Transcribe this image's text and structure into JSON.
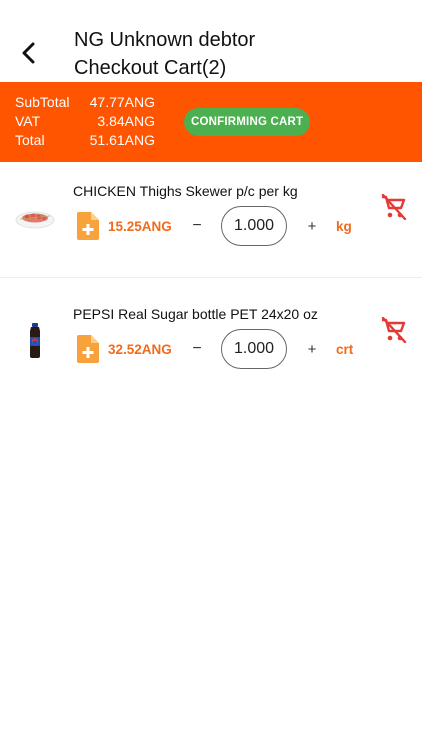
{
  "header": {
    "title_line1": "NG Unknown debtor",
    "title_line2": "Checkout Cart(2)"
  },
  "totals": {
    "subtotal_label": "SubTotal",
    "subtotal_value": "47.77ANG",
    "vat_label": "VAT",
    "vat_value": "3.84ANG",
    "total_label": "Total",
    "total_value": "51.61ANG",
    "confirm_label": "CONFIRMING CART"
  },
  "items": [
    {
      "name": "CHICKEN Thighs Skewer p/c per kg",
      "price": "15.25ANG",
      "minus": "−",
      "quantity": "1.000",
      "plus": "+",
      "unit": "kg",
      "image": "chicken-skewer-image"
    },
    {
      "name": "PEPSI Real Sugar bottle PET 24x20 oz",
      "price": "32.52ANG",
      "minus": "−",
      "quantity": "1.000",
      "plus": "+",
      "unit": "crt",
      "image": "pepsi-bottle-image"
    }
  ],
  "colors": {
    "accent": "#FF5500",
    "price": "#F26A1B",
    "confirm": "#4CAF50",
    "remove": "#E53935",
    "doc_icon": "#F7A23B"
  },
  "icons": {
    "back": "arrow-left-icon",
    "doc": "document-add-icon",
    "remove": "remove-shopping-cart-icon"
  }
}
